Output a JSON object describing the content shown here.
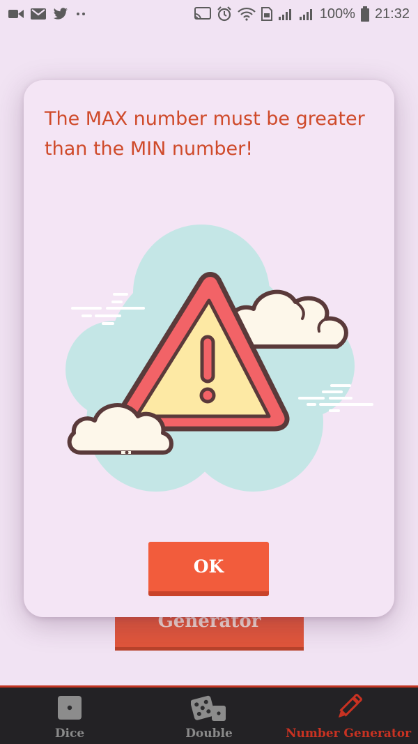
{
  "status_bar": {
    "battery_percent": "100%",
    "time": "21:32",
    "left_icons": [
      "video-camera-icon",
      "gmail-icon",
      "twitter-icon",
      "more-dots-icon"
    ],
    "right_icons": [
      "cast-icon",
      "alarm-icon",
      "wifi-icon",
      "sim-icon",
      "signal-icon",
      "signal-icon",
      "battery-icon"
    ]
  },
  "background": {
    "generate_button_label": "Generator"
  },
  "dialog": {
    "message": "The MAX number must be greater than the MIN number!",
    "ok_label": "OK",
    "illustration": "warning-triangle-with-clouds"
  },
  "bottom_nav": {
    "items": [
      {
        "label": "Dice",
        "icon": "die-single-icon",
        "active": false
      },
      {
        "label": "Double",
        "icon": "dice-double-icon",
        "active": false
      },
      {
        "label": "Number Generator",
        "icon": "pencil-icon",
        "active": true
      }
    ]
  },
  "colors": {
    "accent": "#c83222",
    "dialog_text": "#cf4a2a",
    "ok_button": "#f25c3c",
    "nav_background": "#232225",
    "page_background": "#f1e3f3"
  }
}
